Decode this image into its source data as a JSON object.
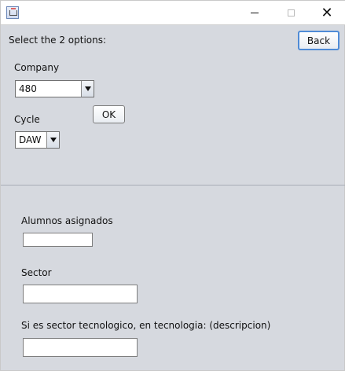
{
  "window": {
    "title": "",
    "controls": {
      "minimize_icon": "minimize-icon",
      "maximize_icon": "maximize-icon",
      "close_icon": "close-icon",
      "close_label": "✕"
    }
  },
  "top": {
    "instruction": "Select the 2 options:",
    "back_label": "Back",
    "company_label": "Company",
    "company_value": "480",
    "cycle_label": "Cycle",
    "cycle_value": "DAW",
    "ok_label": "OK"
  },
  "form": {
    "alumnos_label": "Alumnos asignados",
    "alumnos_value": "",
    "sector_label": "Sector",
    "sector_value": "",
    "tecnologia_label": "Si es sector tecnologico, en tecnologia: (descripcion)",
    "tecnologia_value": ""
  }
}
